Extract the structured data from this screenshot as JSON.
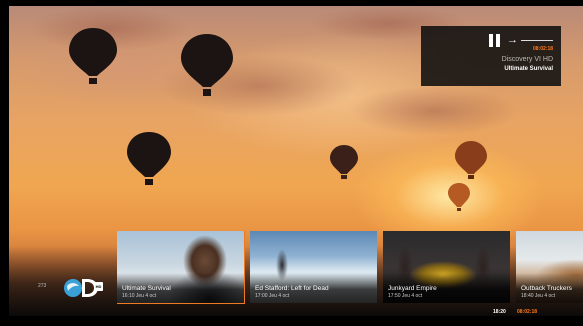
{
  "now_playing": {
    "time": "08:02:18",
    "channel": "Discovery VI HD",
    "show": "Ultimate Survival"
  },
  "footer": {
    "channel_number": "273",
    "hd_label": "HD",
    "clock": "18:20",
    "clock_secondary": "08:02:18"
  },
  "cards": [
    {
      "title": "Ultimate Survival",
      "subtitle": "16:10 Jeu 4 oct"
    },
    {
      "title": "Ed Stafford: Left for Dead",
      "subtitle": "17:00 Jeu 4 oct"
    },
    {
      "title": "Junkyard Empire",
      "subtitle": "17:50 Jeu 4 oct"
    },
    {
      "title": "Outback Truckers",
      "subtitle": "18:40 Jeu 4 oct"
    }
  ],
  "colors": {
    "accent": "#f07a22",
    "panel": "#0f0f0f"
  },
  "icons": {
    "pause": "pause-icon",
    "skip": "arrow-right-icon",
    "logo": "discovery-logo-icon"
  }
}
